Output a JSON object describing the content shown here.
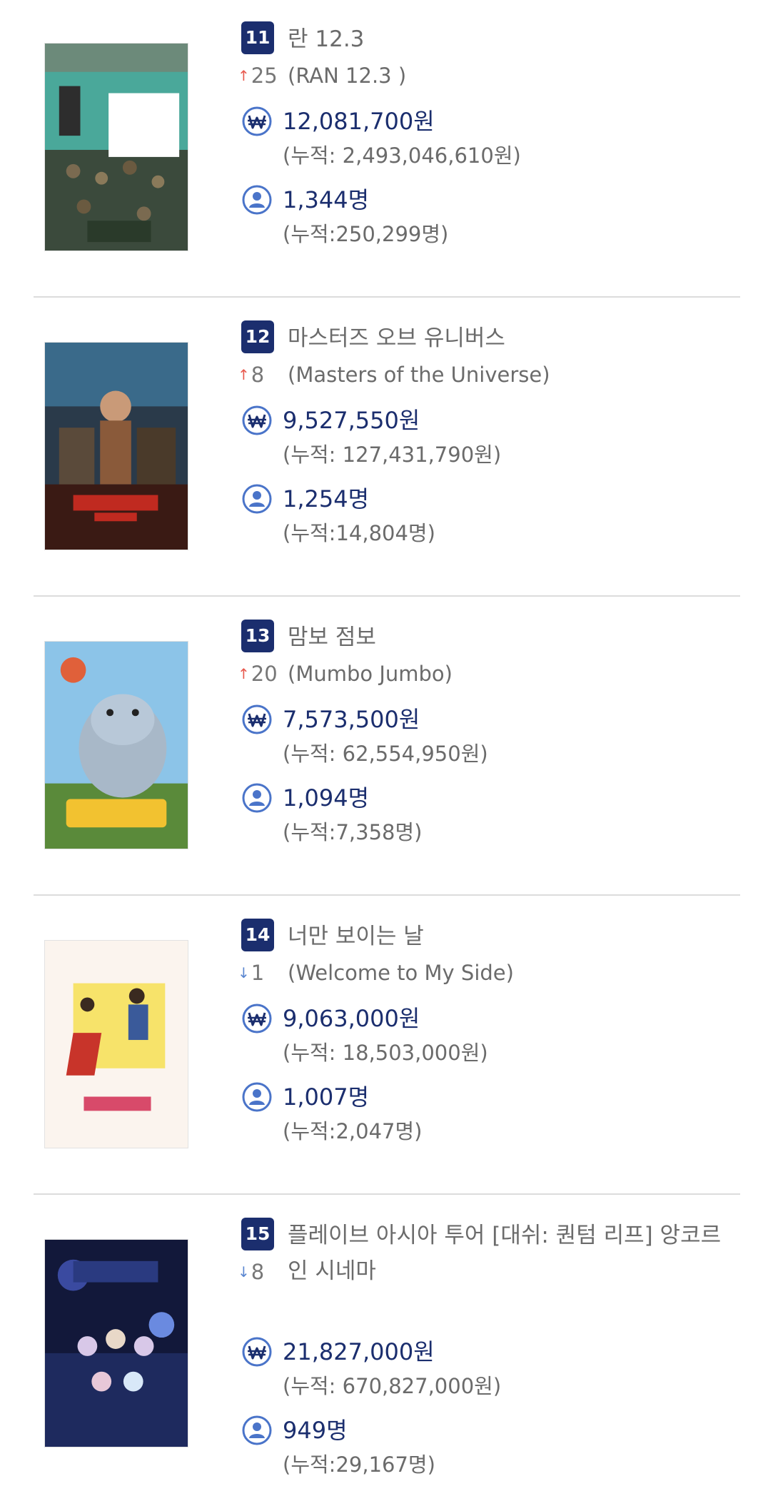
{
  "colors": {
    "rank_badge": "#1b2e6e",
    "value_text": "#1b2e6e",
    "secondary_text": "#6b6b6b",
    "rank_up": "#e8594e",
    "rank_down": "#5a86d0",
    "icon_blue": "#4a74c9"
  },
  "icons": {
    "revenue": "won-icon",
    "audience": "person-icon",
    "rank_up": "arrow-up-icon",
    "rank_down": "arrow-down-icon"
  },
  "movies": [
    {
      "rank": "11",
      "title": "란 12.3",
      "change": "25",
      "direction": "up",
      "title_en": "(RAN 12.3 )",
      "revenue": "12,081,700원",
      "revenue_total": "(누적: 2,493,046,610원)",
      "audience": "1,344명",
      "audience_total": "(누적:250,299명)"
    },
    {
      "rank": "12",
      "title": "마스터즈 오브 유니버스",
      "change": "8",
      "direction": "up",
      "title_en": "(Masters of the Universe)",
      "revenue": "9,527,550원",
      "revenue_total": "(누적: 127,431,790원)",
      "audience": "1,254명",
      "audience_total": "(누적:14,804명)"
    },
    {
      "rank": "13",
      "title": "맘보 점보",
      "change": "20",
      "direction": "up",
      "title_en": "(Mumbo Jumbo)",
      "revenue": "7,573,500원",
      "revenue_total": "(누적: 62,554,950원)",
      "audience": "1,094명",
      "audience_total": "(누적:7,358명)"
    },
    {
      "rank": "14",
      "title": "너만 보이는 날",
      "change": "1",
      "direction": "down",
      "title_en": "(Welcome to My Side)",
      "revenue": "9,063,000원",
      "revenue_total": "(누적: 18,503,000원)",
      "audience": "1,007명",
      "audience_total": "(누적:2,047명)"
    },
    {
      "rank": "15",
      "title": "플레이브 아시아 투어 [대쉬: 퀀텀 리프] 앙코르 인 시네마",
      "change": "8",
      "direction": "down",
      "title_en": "",
      "revenue": "21,827,000원",
      "revenue_total": "(누적: 670,827,000원)",
      "audience": "949명",
      "audience_total": "(누적:29,167명)"
    }
  ]
}
